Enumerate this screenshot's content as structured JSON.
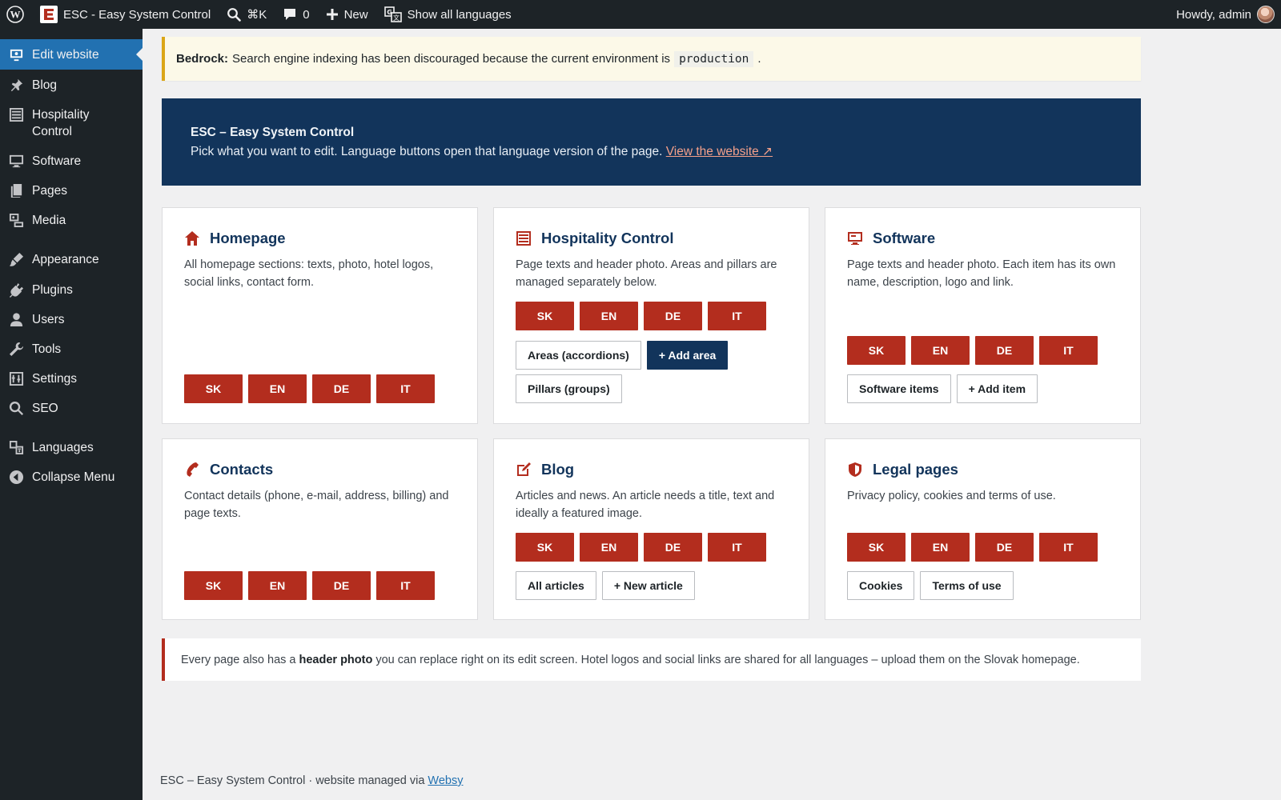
{
  "adminbar": {
    "site_name": "ESC - Easy System Control",
    "search_shortcut": "⌘K",
    "comments_count": "0",
    "new_label": "New",
    "languages_label": "Show all languages",
    "howdy": "Howdy, admin"
  },
  "sidebar": {
    "items": [
      {
        "label": "Edit website",
        "icon": "monitor-eye-icon"
      },
      {
        "label": "Blog",
        "icon": "pin-icon"
      },
      {
        "label": "Hospitality Control",
        "icon": "list-icon"
      },
      {
        "label": "Software",
        "icon": "monitor-icon"
      },
      {
        "label": "Pages",
        "icon": "pages-icon"
      },
      {
        "label": "Media",
        "icon": "media-icon"
      },
      {
        "label": "Appearance",
        "icon": "brush-icon"
      },
      {
        "label": "Plugins",
        "icon": "plug-icon"
      },
      {
        "label": "Users",
        "icon": "user-icon"
      },
      {
        "label": "Tools",
        "icon": "wrench-icon"
      },
      {
        "label": "Settings",
        "icon": "sliders-icon"
      },
      {
        "label": "SEO",
        "icon": "search-icon"
      },
      {
        "label": "Languages",
        "icon": "translate-icon"
      },
      {
        "label": "Collapse Menu",
        "icon": "collapse-icon"
      }
    ]
  },
  "notice": {
    "prefix": "Bedrock:",
    "text": "Search engine indexing has been discouraged because the current environment is",
    "env": "production",
    "suffix": "."
  },
  "hero": {
    "title": "ESC – Easy System Control",
    "text": "Pick what you want to edit. Language buttons open that language version of the page.",
    "link": "View the website ↗"
  },
  "languages": [
    "SK",
    "EN",
    "DE",
    "IT"
  ],
  "cards": {
    "homepage": {
      "title": "Homepage",
      "desc": "All homepage sections: texts, photo, hotel logos, social links, contact form."
    },
    "hospitality": {
      "title": "Hospitality Control",
      "desc": "Page texts and header photo. Areas and pillars are managed separately below.",
      "btn_areas": "Areas (accordions)",
      "btn_add_area": "+ Add area",
      "btn_pillars": "Pillars (groups)"
    },
    "software": {
      "title": "Software",
      "desc": "Page texts and header photo. Each item has its own name, description, logo and link.",
      "btn_items": "Software items",
      "btn_add_item": "+ Add item"
    },
    "contacts": {
      "title": "Contacts",
      "desc": "Contact details (phone, e-mail, address, billing) and page texts."
    },
    "blog": {
      "title": "Blog",
      "desc": "Articles and news. An article needs a title, text and ideally a featured image.",
      "btn_all": "All articles",
      "btn_new": "+ New article"
    },
    "legal": {
      "title": "Legal pages",
      "desc": "Privacy policy, cookies and terms of use.",
      "btn_cookies": "Cookies",
      "btn_terms": "Terms of use"
    }
  },
  "info": {
    "pre": "Every page also has a",
    "bold": "header photo",
    "post": "you can replace right on its edit screen. Hotel logos and social links are shared for all languages – upload them on the Slovak homepage."
  },
  "footer": {
    "text": "ESC – Easy System Control · website managed via",
    "link": "Websy"
  },
  "colors": {
    "accent_red": "#b32d1e",
    "navy": "#12345b",
    "wp_blue": "#2271b1",
    "admin_dark": "#1d2327"
  }
}
